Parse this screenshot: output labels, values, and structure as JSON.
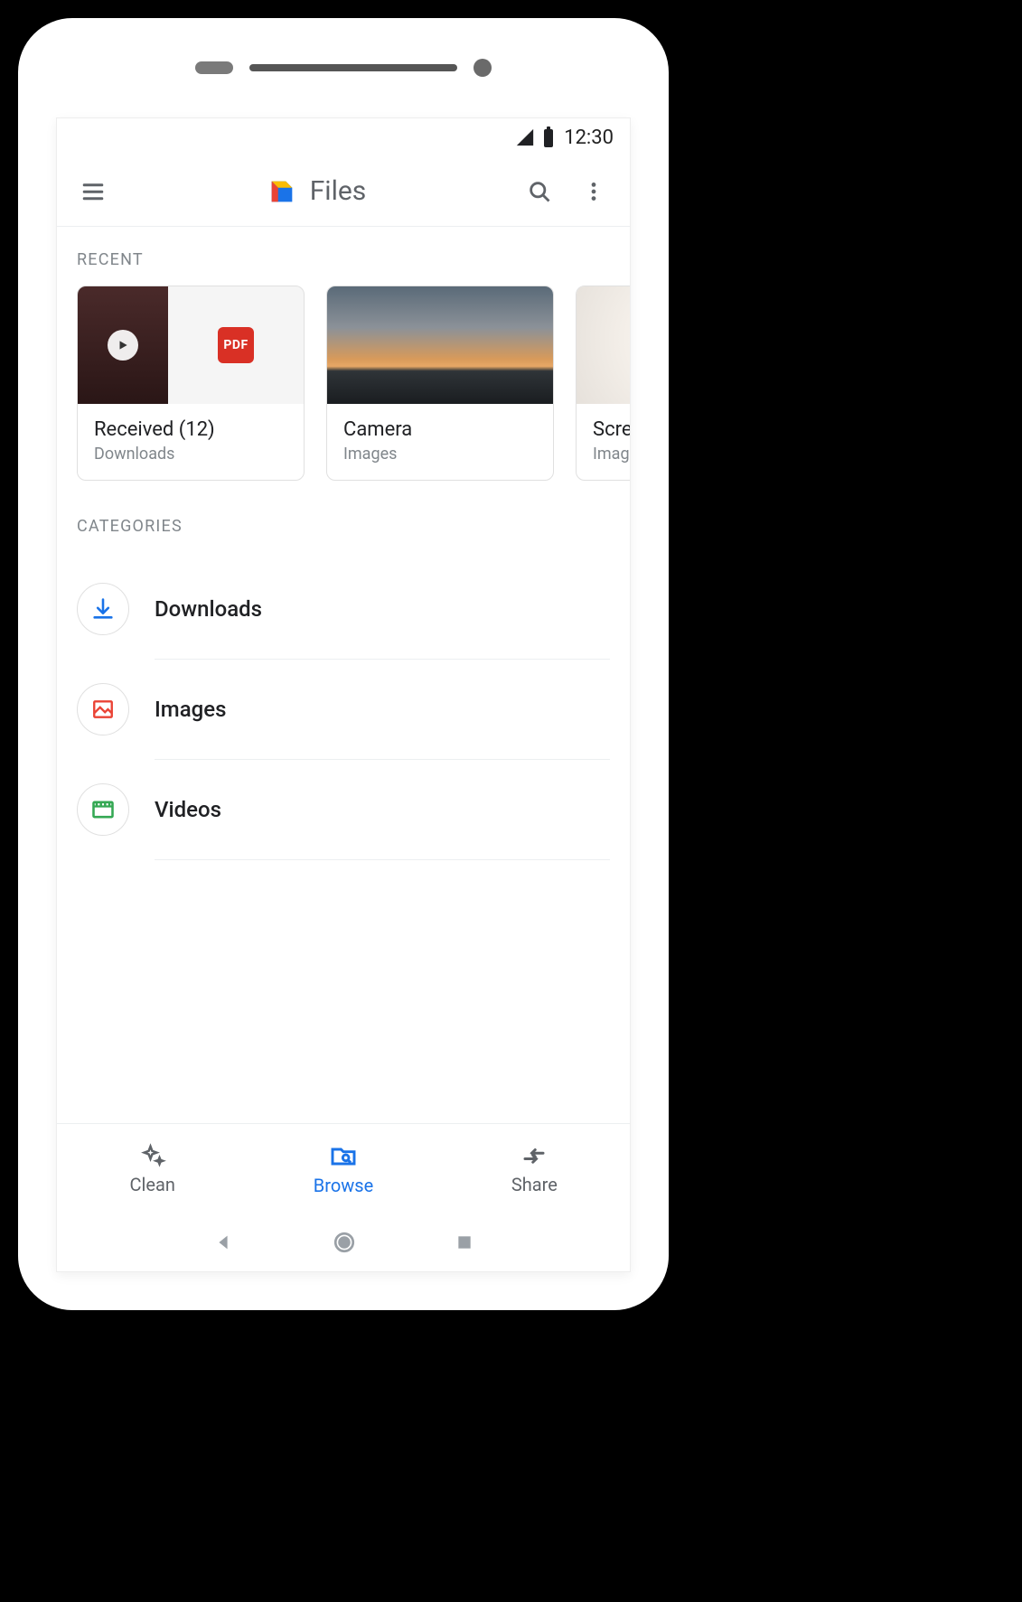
{
  "status": {
    "time": "12:30"
  },
  "appbar": {
    "title": "Files"
  },
  "sections": {
    "recent": "Recent",
    "categories": "Categories"
  },
  "recent_cards": [
    {
      "title": "Received (12)",
      "subtitle": "Downloads",
      "pdf_badge": "PDF"
    },
    {
      "title": "Camera",
      "subtitle": "Images"
    },
    {
      "title": "Screenshots",
      "subtitle": "Images"
    }
  ],
  "categories": [
    {
      "label": "Downloads"
    },
    {
      "label": "Images"
    },
    {
      "label": "Videos"
    }
  ],
  "bottom_nav": {
    "items": [
      {
        "label": "Clean",
        "active": false
      },
      {
        "label": "Browse",
        "active": true
      },
      {
        "label": "Share",
        "active": false
      }
    ]
  }
}
